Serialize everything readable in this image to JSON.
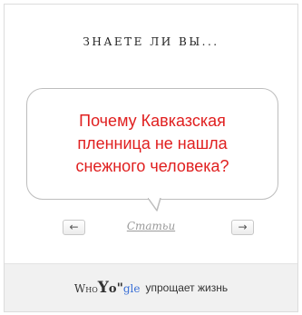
{
  "widget": {
    "heading": "ЗНАЕТЕ ЛИ ВЫ...",
    "question": "Почему Кавказская пленница не нашла снежного человека?",
    "nav": {
      "prev_label": "←",
      "next_label": "→",
      "articles_label": "Статьи"
    }
  },
  "footer": {
    "logo": {
      "who": "Who",
      "y": "Y",
      "o": "o",
      "q": "\"",
      "gle": "gle"
    },
    "slogan": "упрощает жизнь"
  },
  "colors": {
    "question_text": "#e02020",
    "bubble_border": "#bdbdbd",
    "footer_bg": "#f1f1f1",
    "logo_accent": "#3a6fd6"
  }
}
